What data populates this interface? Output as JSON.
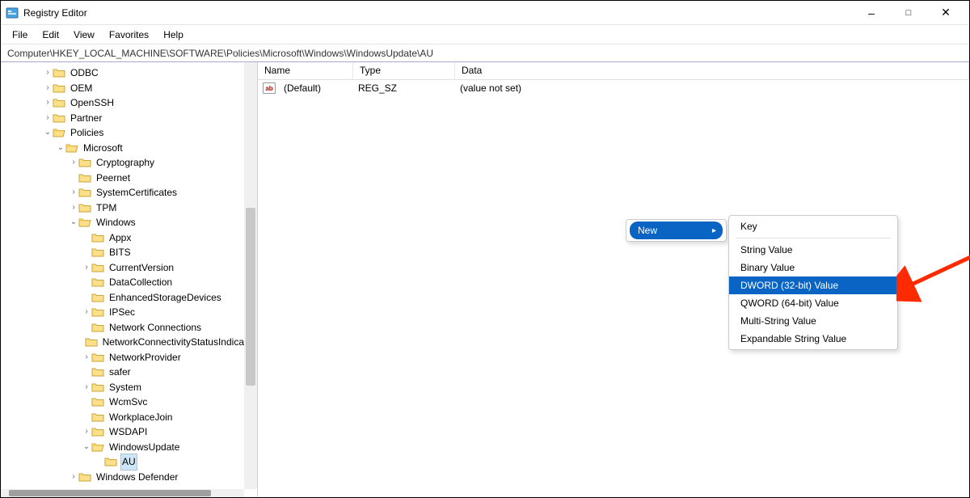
{
  "titlebar": {
    "title": "Registry Editor"
  },
  "menubar": [
    "File",
    "Edit",
    "View",
    "Favorites",
    "Help"
  ],
  "address": "Computer\\HKEY_LOCAL_MACHINE\\SOFTWARE\\Policies\\Microsoft\\Windows\\WindowsUpdate\\AU",
  "tree": [
    {
      "indent": 3,
      "tw": ">",
      "label": "ODBC"
    },
    {
      "indent": 3,
      "tw": ">",
      "label": "OEM"
    },
    {
      "indent": 3,
      "tw": ">",
      "label": "OpenSSH"
    },
    {
      "indent": 3,
      "tw": ">",
      "label": "Partner"
    },
    {
      "indent": 3,
      "tw": "v",
      "label": "Policies",
      "open": true
    },
    {
      "indent": 4,
      "tw": "v",
      "label": "Microsoft",
      "open": true
    },
    {
      "indent": 5,
      "tw": ">",
      "label": "Cryptography"
    },
    {
      "indent": 5,
      "tw": "",
      "label": "Peernet"
    },
    {
      "indent": 5,
      "tw": ">",
      "label": "SystemCertificates"
    },
    {
      "indent": 5,
      "tw": ">",
      "label": "TPM"
    },
    {
      "indent": 5,
      "tw": "v",
      "label": "Windows",
      "open": true
    },
    {
      "indent": 6,
      "tw": "",
      "label": "Appx"
    },
    {
      "indent": 6,
      "tw": "",
      "label": "BITS"
    },
    {
      "indent": 6,
      "tw": ">",
      "label": "CurrentVersion"
    },
    {
      "indent": 6,
      "tw": "",
      "label": "DataCollection"
    },
    {
      "indent": 6,
      "tw": "",
      "label": "EnhancedStorageDevices"
    },
    {
      "indent": 6,
      "tw": ">",
      "label": "IPSec"
    },
    {
      "indent": 6,
      "tw": "",
      "label": "Network Connections"
    },
    {
      "indent": 6,
      "tw": "",
      "label": "NetworkConnectivityStatusIndicator"
    },
    {
      "indent": 6,
      "tw": ">",
      "label": "NetworkProvider"
    },
    {
      "indent": 6,
      "tw": "",
      "label": "safer"
    },
    {
      "indent": 6,
      "tw": ">",
      "label": "System"
    },
    {
      "indent": 6,
      "tw": "",
      "label": "WcmSvc"
    },
    {
      "indent": 6,
      "tw": "",
      "label": "WorkplaceJoin"
    },
    {
      "indent": 6,
      "tw": ">",
      "label": "WSDAPI"
    },
    {
      "indent": 6,
      "tw": "v",
      "label": "WindowsUpdate",
      "open": true
    },
    {
      "indent": 7,
      "tw": "",
      "label": "AU",
      "selected": true
    },
    {
      "indent": 5,
      "tw": ">",
      "label": "Windows Defender"
    }
  ],
  "columns": {
    "name": "Name",
    "type": "Type",
    "data": "Data"
  },
  "values": [
    {
      "name": "(Default)",
      "type": "REG_SZ",
      "data": "(value not set)"
    }
  ],
  "context": {
    "new_label": "New",
    "sub": [
      {
        "label": "Key",
        "sep_after": true
      },
      {
        "label": "String Value"
      },
      {
        "label": "Binary Value"
      },
      {
        "label": "DWORD (32-bit) Value",
        "hl": true
      },
      {
        "label": "QWORD (64-bit) Value"
      },
      {
        "label": "Multi-String Value"
      },
      {
        "label": "Expandable String Value"
      }
    ]
  }
}
